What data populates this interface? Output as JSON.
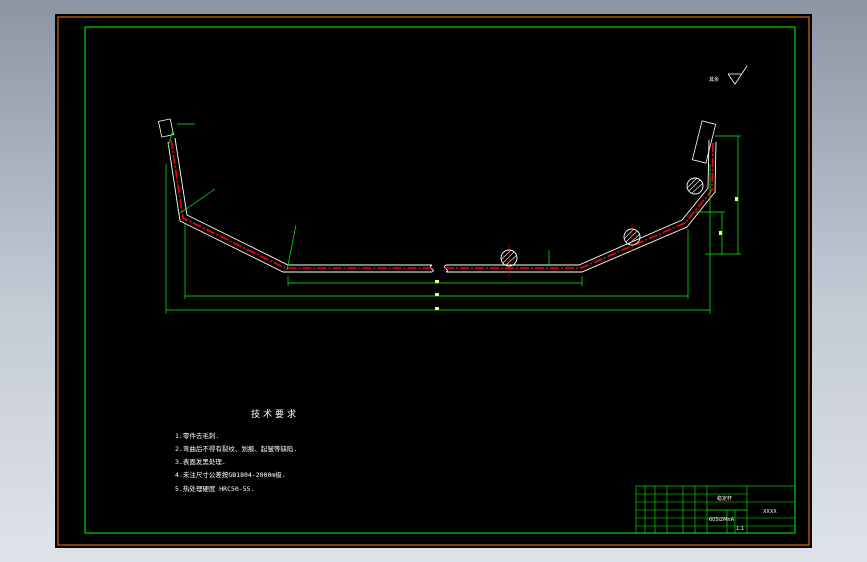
{
  "technical_requirements": {
    "title": "技术要求",
    "lines": [
      "1.零件去毛刺.",
      "2.弯曲后不得有裂纹、划痕、起皱等缺陷.",
      "3.表面发黑处理.",
      "4.未注尺寸公差按GB1804-2000m级.",
      "5.热处理硬度 HRC50-55."
    ]
  },
  "surface_finish": {
    "label": "其余"
  },
  "title_block": {
    "part_name": "稳定杆",
    "drawing_number": "XXXX",
    "material": "60Si2MnA",
    "scale": "1:1"
  },
  "colors": {
    "border_outer": "#ff8000",
    "frame": "#00ff00",
    "part": "#ff0000",
    "white": "#ffffff",
    "dimension": "#00ff00"
  }
}
